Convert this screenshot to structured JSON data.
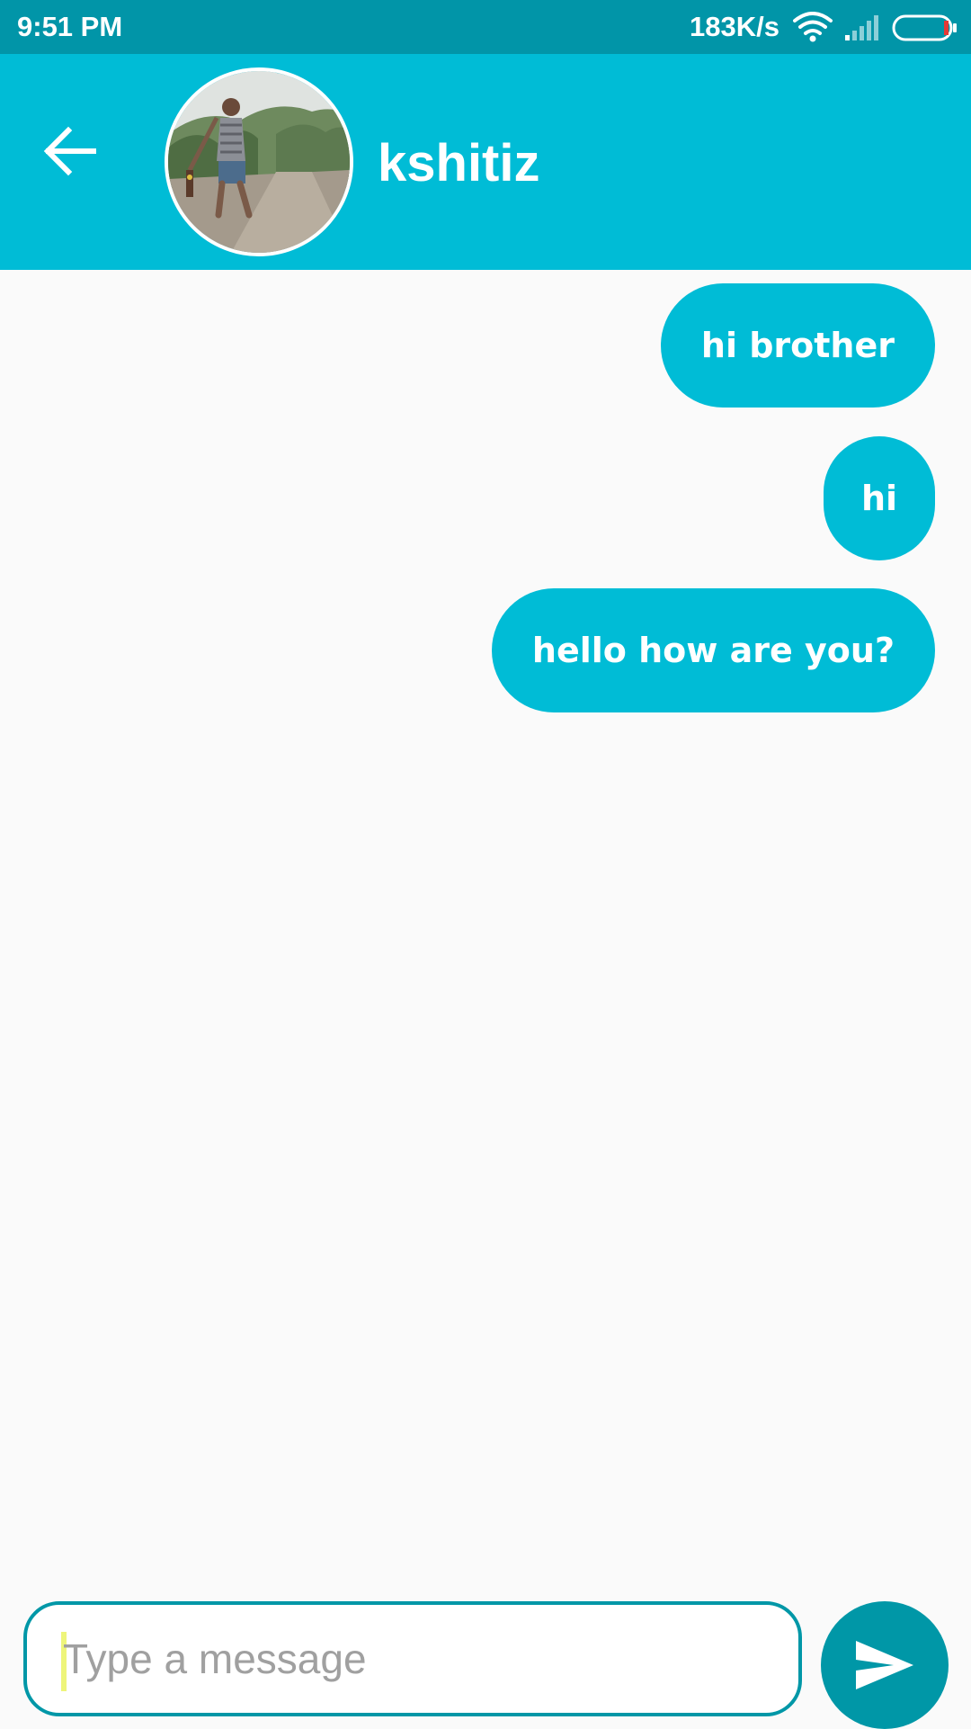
{
  "status_bar": {
    "time": "9:51 PM",
    "network_speed": "183K/s",
    "icons": [
      "wifi-icon",
      "signal-icon",
      "battery-icon"
    ],
    "battery_low_color": "#e53935"
  },
  "header": {
    "back_icon": "back-arrow-icon",
    "contact_name": "kshitiz",
    "avatar": "contact-avatar-photo"
  },
  "messages": [
    {
      "text": "hi brother",
      "direction": "sent"
    },
    {
      "text": "hi",
      "direction": "sent"
    },
    {
      "text": "hello how are you?",
      "direction": "sent"
    }
  ],
  "composer": {
    "placeholder": "Type a message",
    "value": "",
    "send_icon": "send-icon"
  },
  "colors": {
    "status_bar": "#0195a8",
    "app_bar": "#00bcd6",
    "bubble": "#00bcd6",
    "send_button": "#0097a7",
    "input_border": "#0097a7",
    "background": "#fafafa"
  }
}
